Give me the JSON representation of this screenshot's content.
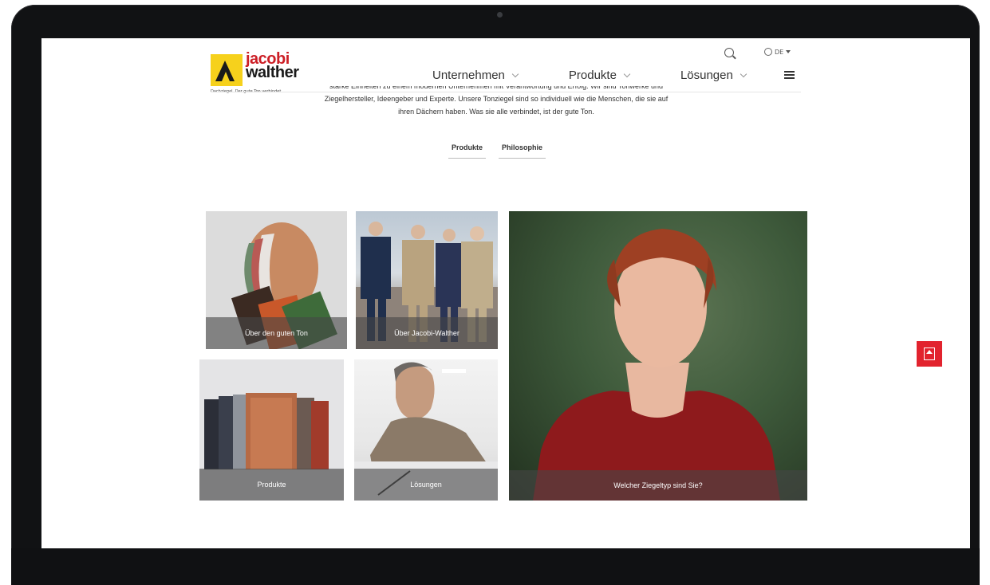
{
  "header": {
    "logo": {
      "line1": "jacobi",
      "line2": "walther",
      "tagline": "Dachziegel. Der gute Ton verbindet."
    },
    "nav": [
      {
        "label": "Unternehmen"
      },
      {
        "label": "Produkte"
      },
      {
        "label": "Lösungen"
      }
    ],
    "language": "DE"
  },
  "intro": {
    "line1": "starke Einheiten zu einem modernen Unternehmen mit Verantwortung und Erfolg. Wir sind Tonwerke und",
    "line2": "Ziegelhersteller, Ideengeber und Experte. Unsere Tonziegel sind so individuell wie die Menschen, die sie auf",
    "line3": "ihren Dächern haben. Was sie alle verbindet, ist der gute Ton."
  },
  "tabs": [
    {
      "label": "Produkte"
    },
    {
      "label": "Philosophie"
    }
  ],
  "tiles": [
    {
      "caption": "Über den guten Ton"
    },
    {
      "caption": "Über Jacobi-Walther"
    },
    {
      "caption": "Produkte"
    },
    {
      "caption": "Lösungen"
    },
    {
      "caption": "Welcher Ziegeltyp sind Sie?"
    }
  ],
  "colors": {
    "accent": "#e2232e",
    "logo_yellow": "#f6d11c",
    "logo_red": "#cc1f26"
  }
}
